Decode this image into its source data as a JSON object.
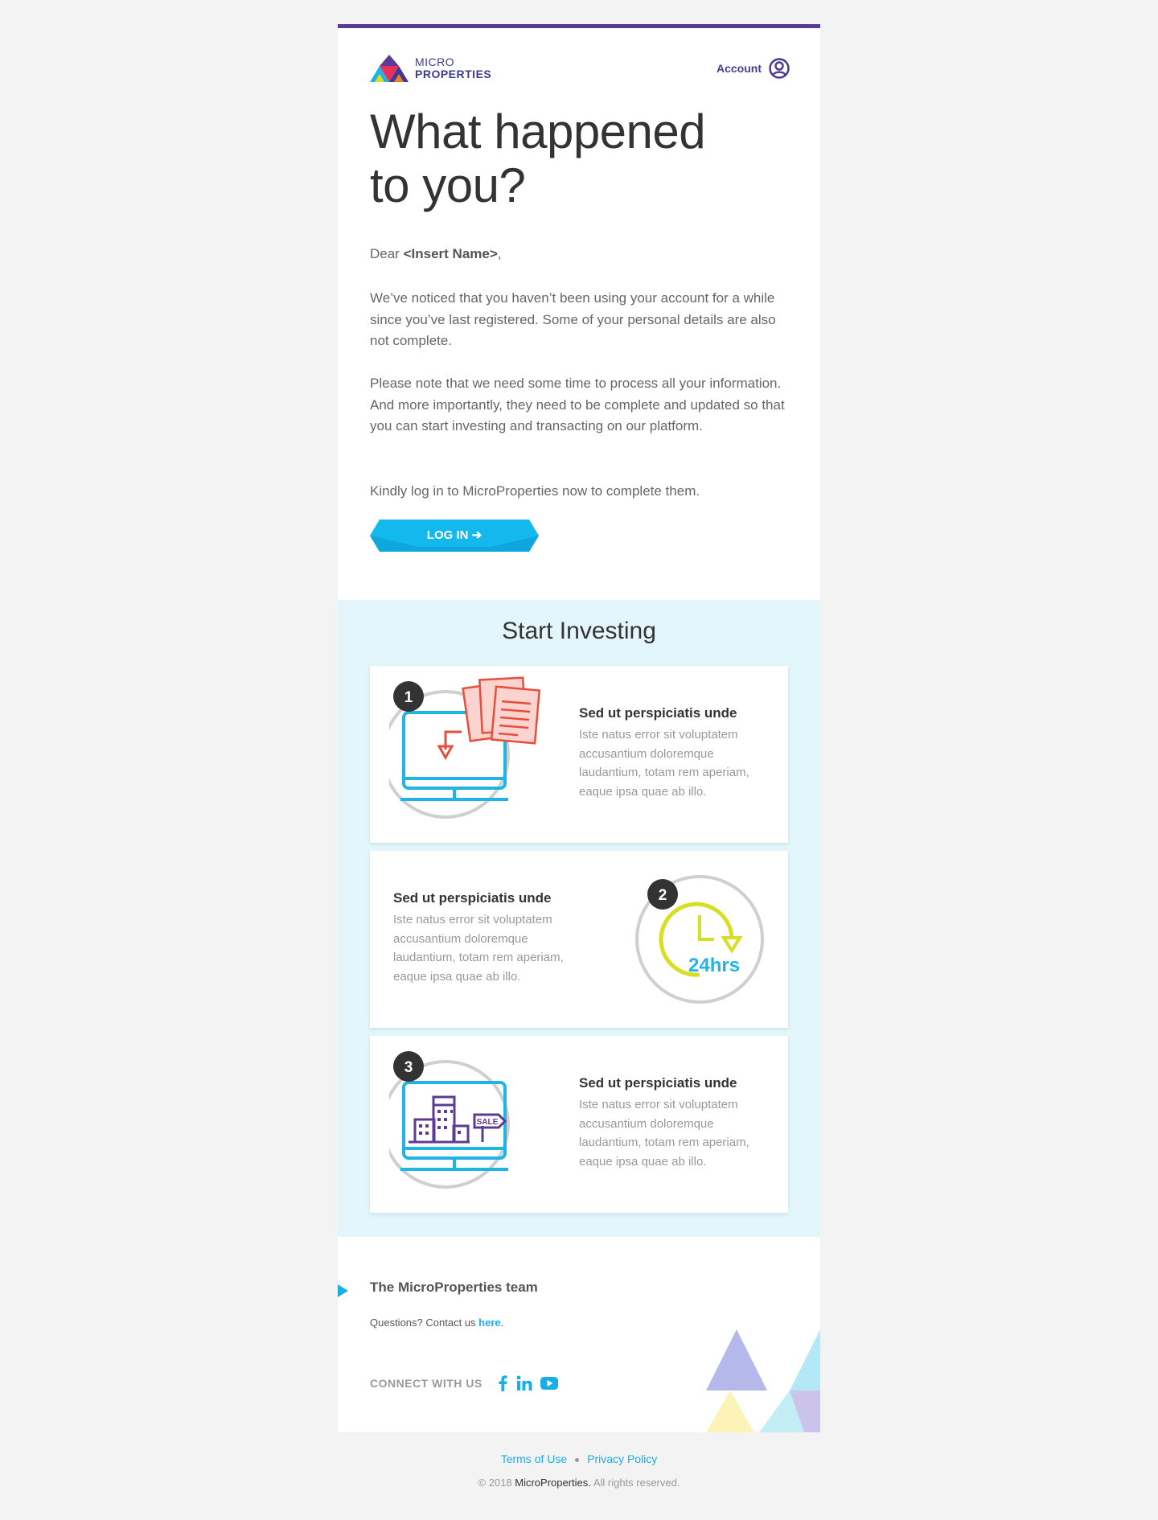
{
  "header": {
    "logo_line1": "MICRO",
    "logo_line2": "PROPERTIES",
    "account_label": "Account"
  },
  "hero": {
    "headline_line1": "What happened",
    "headline_line2": "to you?"
  },
  "letter": {
    "dear": "Dear",
    "name": "<Insert Name>",
    "comma": ",",
    "paragraph1": "We’ve noticed that you haven’t been using your account for a while since you’ve last registered. Some of your personal details are also not complete.",
    "paragraph2": "Please note that we need some time to process all your information. And more importantly, they need to be complete and updated so that you can start investing and transacting on our platform.",
    "paragraph3": "Kindly log in to MicroProperties now to complete them.",
    "login_button": "LOG IN ➔"
  },
  "invest": {
    "title": "Start Investing",
    "cards": [
      {
        "number": "1",
        "title": "Sed ut perspiciatis unde",
        "body": "Iste natus error sit voluptatem accusantium doloremque laudantium, totam rem aperiam, eaque ipsa quae ab illo."
      },
      {
        "number": "2",
        "title": "Sed ut perspiciatis unde",
        "body": "Iste natus error sit voluptatem accusantium doloremque laudantium, totam rem aperiam, eaque ipsa quae ab illo.",
        "badge_text": "24hrs"
      },
      {
        "number": "3",
        "title": "Sed ut perspiciatis unde",
        "body": "Iste natus error sit voluptatem accusantium doloremque laudantium, totam rem aperiam, eaque ipsa quae ab illo.",
        "sign_text": "SALE"
      }
    ]
  },
  "signoff": {
    "team": "The MicroProperties team",
    "questions": "Questions? Contact us",
    "here_link": "here",
    "period": ".",
    "connect_label": "CONNECT WITH US",
    "social_icons": [
      "facebook-icon",
      "linkedin-icon",
      "youtube-icon"
    ]
  },
  "footer": {
    "terms": "Terms of Use",
    "privacy": "Privacy Policy",
    "copyright_prefix": "© 2018",
    "brand": "MicroProperties.",
    "rights": "All rights reserved."
  },
  "colors": {
    "accent_purple": "#5b3b94",
    "accent_blue": "#19aee7",
    "section_bg": "#e3f6fb",
    "page_bg": "#f3f3f3"
  }
}
